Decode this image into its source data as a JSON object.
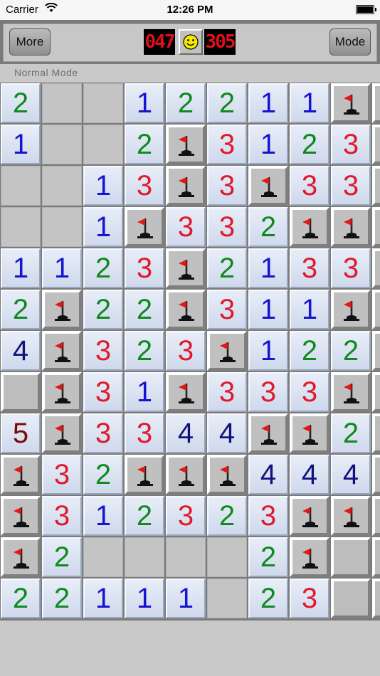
{
  "status_bar": {
    "carrier": "Carrier",
    "time": "12:26 PM"
  },
  "toolbar": {
    "more_label": "More",
    "mode_label": "Mode",
    "mines_remaining": "047",
    "timer": "305",
    "lcd_color": "#e0101a",
    "smiley_color": "#f4ec00"
  },
  "mode_text": "Normal Mode",
  "colors": {
    "1": "#1414d2",
    "2": "#0f8a1e",
    "3": "#e0192c",
    "4": "#12127e",
    "5": "#7c0a0a"
  },
  "board": {
    "legend": "number = revealed count, '.' = revealed empty, 'F' = flagged, 'H' = unrevealed",
    "rows": [
      [
        "2",
        ".",
        ".",
        "1",
        "2",
        "2",
        "1",
        "1",
        "F",
        "H"
      ],
      [
        "1",
        ".",
        ".",
        "2",
        "F",
        "3",
        "1",
        "2",
        "3",
        "H"
      ],
      [
        ".",
        ".",
        "1",
        "3",
        "F",
        "3",
        "F",
        "3",
        "3",
        "H"
      ],
      [
        ".",
        ".",
        "1",
        "F",
        "3",
        "3",
        "2",
        "F",
        "F",
        "H"
      ],
      [
        "1",
        "1",
        "2",
        "3",
        "F",
        "2",
        "1",
        "3",
        "3",
        "H"
      ],
      [
        "2",
        "F",
        "2",
        "2",
        "F",
        "3",
        "1",
        "1",
        "F",
        "H"
      ],
      [
        "4",
        "F",
        "3",
        "2",
        "3",
        "F",
        "1",
        "2",
        "2",
        "H"
      ],
      [
        "H",
        "F",
        "3",
        "1",
        "F",
        "3",
        "3",
        "3",
        "F",
        "H"
      ],
      [
        "5",
        "F",
        "3",
        "3",
        "4",
        "4",
        "F",
        "F",
        "2",
        "H"
      ],
      [
        "F",
        "3",
        "2",
        "F",
        "F",
        "F",
        "4",
        "4",
        "4",
        "H"
      ],
      [
        "F",
        "3",
        "1",
        "2",
        "3",
        "2",
        "3",
        "F",
        "F",
        "H"
      ],
      [
        "F",
        "2",
        ".",
        ".",
        ".",
        ".",
        "2",
        "F",
        "H",
        "H"
      ],
      [
        "2",
        "2",
        "1",
        "1",
        "1",
        ".",
        "2",
        "3",
        "H",
        "H"
      ]
    ]
  }
}
